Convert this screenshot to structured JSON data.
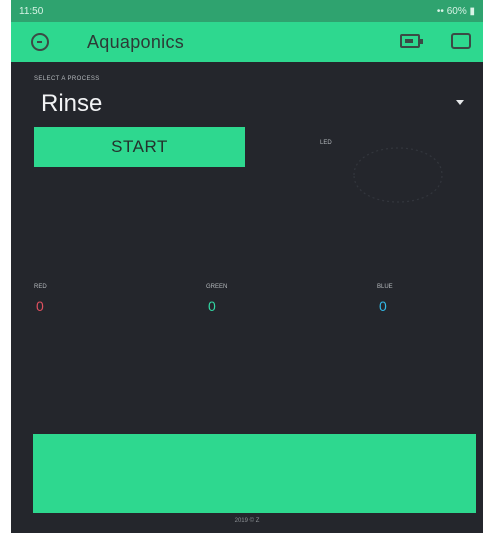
{
  "statusbar": {
    "time": "11:50",
    "right": "•• 60% ▮"
  },
  "appbar": {
    "title": "Aquaponics"
  },
  "process": {
    "label": "SELECT A PROCESS",
    "value": "Rinse"
  },
  "start_button": {
    "label": "START"
  },
  "led": {
    "label": "LED"
  },
  "rgb": {
    "red": {
      "label": "RED",
      "value": "0",
      "color": "#e0505f"
    },
    "green": {
      "label": "GREEN",
      "value": "0",
      "color": "#32d7a3"
    },
    "blue": {
      "label": "BLUE",
      "value": "0",
      "color": "#32b8e6"
    }
  },
  "colors": {
    "accent": "#2ed88f",
    "background": "#24262c"
  },
  "footer": {
    "text": "2019 © Z"
  }
}
